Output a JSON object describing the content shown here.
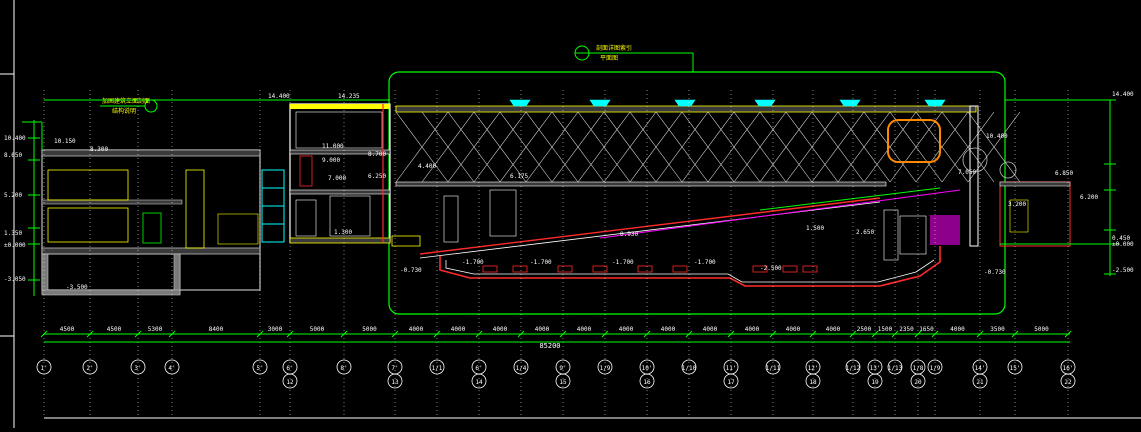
{
  "colors": {
    "background": "#000000",
    "grid": "#ffffff",
    "dimension": "#00ff00",
    "structure": "#ff2a2a",
    "elevation": "#ffff00",
    "glass": "#00ffff",
    "roof_truss": "#d8d8d8",
    "seating": "#ff00ff",
    "wall": "#bfbfbf"
  },
  "title_callout": {
    "line1": "剖面详图索引",
    "line2": "平面图"
  },
  "left_callout": {
    "line1": "加固建筑立面剖面",
    "line2": "结构说明"
  },
  "elevations": {
    "top_left": "14.400",
    "top_mid": "14.235",
    "top_right": "14.400",
    "left_1": "10.400",
    "left_2": "10.150",
    "left_3": "8.650",
    "left_4": "8.300",
    "left_5": "5.200",
    "left_6": "1.350",
    "left_7": "±0.000",
    "left_8": "-3.050",
    "left_9": "-3.500",
    "mid_1": "11.000",
    "mid_2": "9.000",
    "mid_3": "8.700",
    "mid_4": "7.000",
    "mid_5": "6.250",
    "mid_6": "1.300",
    "mid_7": "4.400",
    "hall_1": "6.175",
    "hall_2": "0.930",
    "hall_3": "-0.730",
    "hall_4": "-1.700",
    "hall_5": "-1.700",
    "hall_6": "-1.700",
    "hall_7": "-1.700",
    "hall_8": "-2.500",
    "hall_9": "1.500",
    "hall_10": "2.650",
    "right_1": "10.400",
    "right_2": "7.050",
    "right_3": "6.850",
    "right_4": "6.200",
    "right_5": "3.200",
    "right_6": "0.450",
    "right_7": "±0.000",
    "right_8": "-2.500",
    "right_9": "-0.730"
  },
  "dimensions": [
    "4500",
    "4500",
    "5300",
    "8400",
    "3000",
    "5000",
    "5000",
    "4000",
    "4000",
    "4000",
    "4000",
    "4000",
    "4000",
    "4000",
    "4000",
    "4000",
    "4000",
    "4000",
    "2500",
    "1500",
    "2350",
    "1650",
    "4000",
    "3500",
    "5000"
  ],
  "total_dimension": "85200",
  "axes_top": [
    "1'",
    "2'",
    "3'",
    "4'",
    "5'",
    "6'",
    "8'",
    "7'",
    "1/1",
    "6'",
    "1/4",
    "9'",
    "1/9",
    "10'",
    "1/10",
    "11'",
    "1/11",
    "12'",
    "1/12",
    "13'",
    "1/13",
    "1/8",
    "1/9",
    "14'",
    "15'",
    "16'"
  ],
  "axes_bottom": [
    "12",
    "13",
    "14",
    "15",
    "16",
    "17",
    "18",
    "19",
    "20",
    "21",
    "22"
  ]
}
